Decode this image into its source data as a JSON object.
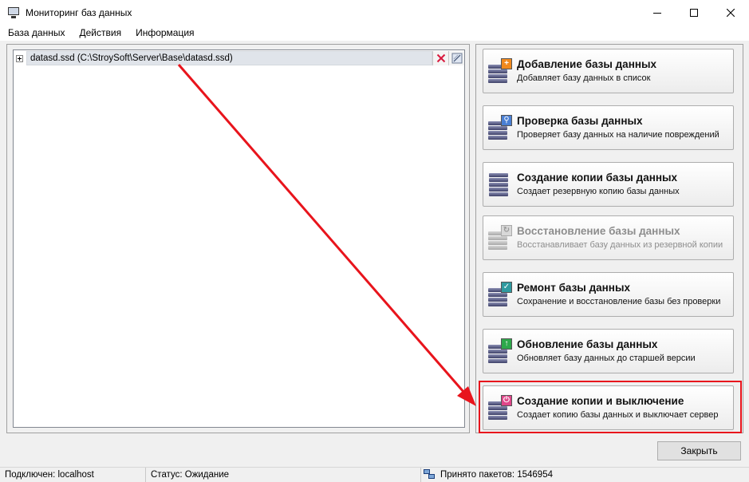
{
  "window": {
    "title": "Мониторинг баз данных"
  },
  "menu": [
    {
      "label": "База данных"
    },
    {
      "label": "Действия"
    },
    {
      "label": "Информация"
    }
  ],
  "tree": {
    "items": [
      {
        "label": "datasd.ssd (C:\\StroySoft\\Server\\Base\\datasd.ssd)"
      }
    ]
  },
  "actions": [
    {
      "title": "Добавление базы данных",
      "desc": "Добавляет базу данных в список",
      "icon": "database-add-icon",
      "badge_color": "#f28a1e",
      "enabled": true
    },
    {
      "title": "Проверка базы данных",
      "desc": "Проверяет базу данных на наличие повреждений",
      "icon": "database-check-icon",
      "badge_color": "#4a7fd4",
      "enabled": true
    },
    {
      "title": "Создание копии базы данных",
      "desc": "Создает резервную копию базы данных",
      "icon": "database-copy-icon",
      "badge_color": "",
      "enabled": true
    },
    {
      "title": "Восстановление базы данных",
      "desc": "Восстанавливает базу данных из резервной копии",
      "icon": "database-restore-icon",
      "badge_color": "#cfcfcf",
      "enabled": false
    },
    {
      "title": "Ремонт базы данных",
      "desc": "Сохранение и восстановление базы без проверки",
      "icon": "database-repair-icon",
      "badge_color": "#2f9aa0",
      "enabled": true
    },
    {
      "title": "Обновление базы данных",
      "desc": "Обновляет базу данных до старшей версии",
      "icon": "database-update-icon",
      "badge_color": "#2ea84a",
      "enabled": true
    },
    {
      "title": "Создание копии и выключение",
      "desc": "Создает копию базы данных и выключает сервер",
      "icon": "database-copy-shutdown-icon",
      "badge_color": "#e0468a",
      "enabled": true
    }
  ],
  "close_label": "Закрыть",
  "status": {
    "connection": "Подключен: localhost",
    "state": "Статус: Ожидание",
    "packets": "Принято пакетов: 1546954"
  },
  "colors": {
    "highlight": "#e8141c",
    "arrow": "#e8141c",
    "selection": "#e0e4ea"
  }
}
